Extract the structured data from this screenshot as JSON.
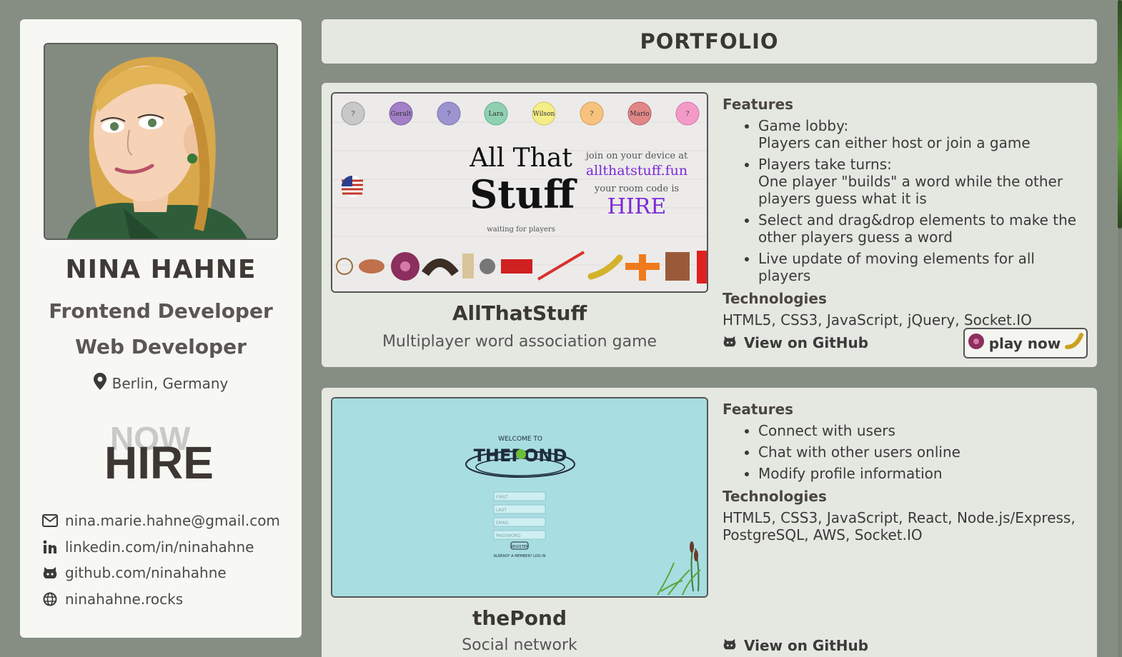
{
  "profile": {
    "name": "NINA HAHNE",
    "role1": "Frontend Developer",
    "role2": "Web Developer",
    "location": "Berlin, Germany",
    "hire_badge": {
      "back": "NOW",
      "front": "HIRE"
    },
    "contacts": [
      {
        "icon": "mail-icon",
        "text": "nina.marie.hahne@gmail.com"
      },
      {
        "icon": "linkedin-icon",
        "text": "linkedin.com/in/ninahahne"
      },
      {
        "icon": "github-icon",
        "text": "github.com/ninahahne"
      },
      {
        "icon": "globe-icon",
        "text": "ninahahne.rocks"
      }
    ]
  },
  "header": {
    "title": "PORTFOLIO"
  },
  "projects": [
    {
      "title": "AllThatStuff",
      "subtitle": "Multiplayer word association game",
      "features_heading": "Features",
      "features": [
        "Game lobby:\nPlayers can either host or join a game",
        "Players take turns:\nOne player \"builds\" a word while the other players guess what it is",
        "Select and drag&drop elements to make the other players guess a word",
        "Live update of moving elements for all players"
      ],
      "tech_heading": "Technologies",
      "technologies": "HTML5, CSS3, JavaScript, jQuery, Socket.IO",
      "github_label": "View on GitHub",
      "play_label": "play now",
      "screenshot": {
        "players": [
          "?",
          "Geralt",
          "?",
          "Lara",
          "Wilson",
          "?",
          "Mario",
          "?"
        ],
        "title_line1": "All That",
        "title_line2": "Stuff",
        "waiting": "waiting for players",
        "join_text": "join on your device at",
        "url": "allthatstuff.fun",
        "room_text": "your room code is",
        "room_code": "HIRE"
      }
    },
    {
      "title": "thePond",
      "subtitle": "Social network",
      "features_heading": "Features",
      "features": [
        "Connect with users",
        "Chat with other users online",
        "Modify profile information"
      ],
      "tech_heading": "Technologies",
      "technologies": "HTML5, CSS3, JavaScript, React, Node.js/Express, PostgreSQL, AWS, Socket.IO",
      "github_label": "View on GitHub",
      "screenshot": {
        "welcome": "WELCOME TO",
        "logo": "THEPOND",
        "fields": [
          "FIRST",
          "LAST",
          "EMAIL",
          "PASSWORD"
        ],
        "button": "REGISTER",
        "footer": "ALREADY A MEMBER? LOG IN"
      }
    }
  ],
  "colors": {
    "background": "#868d83",
    "sidebar": "#f7f8f3",
    "card": "#e5e8e1",
    "pond_bg": "#a8dde2",
    "room_code": "#7b2ad6"
  }
}
